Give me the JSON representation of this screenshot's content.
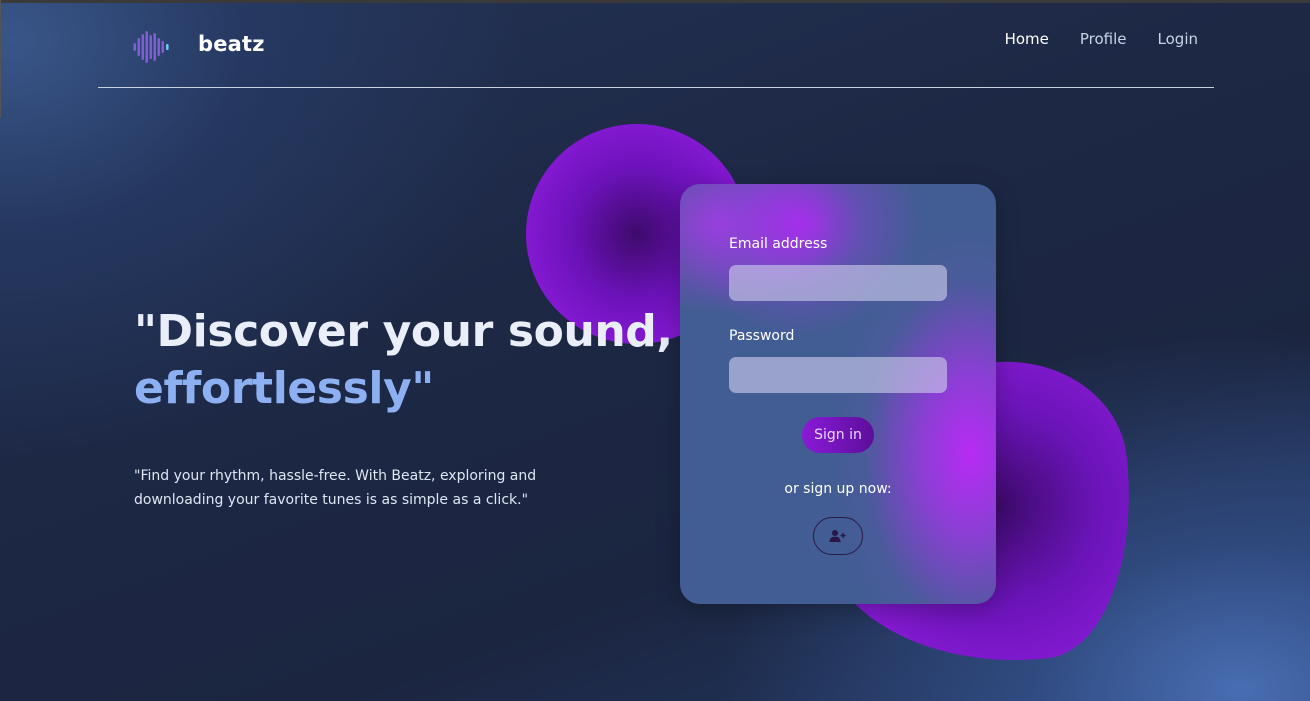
{
  "brand": {
    "name": "beatz",
    "logo_icon": "sound-wave-icon"
  },
  "nav": {
    "items": [
      {
        "label": "Home",
        "active": true
      },
      {
        "label": "Profile",
        "active": false
      },
      {
        "label": "Login",
        "active": false
      }
    ]
  },
  "hero": {
    "headline_line1": "\"Discover your sound,",
    "headline_line2": "effortlessly\"",
    "tagline": "\"Find your rhythm, hassle-free. With Beatz, exploring and downloading your favorite tunes is as simple as a click.\""
  },
  "login_form": {
    "email_label": "Email address",
    "email_value": "",
    "password_label": "Password",
    "password_value": "",
    "signin_label": "Sign in",
    "signup_prompt": "or sign up now:",
    "signup_icon": "user-plus-icon"
  },
  "colors": {
    "accent": "#8cb0f2",
    "purple": "#8b1bd9",
    "background": "#1d2845"
  }
}
